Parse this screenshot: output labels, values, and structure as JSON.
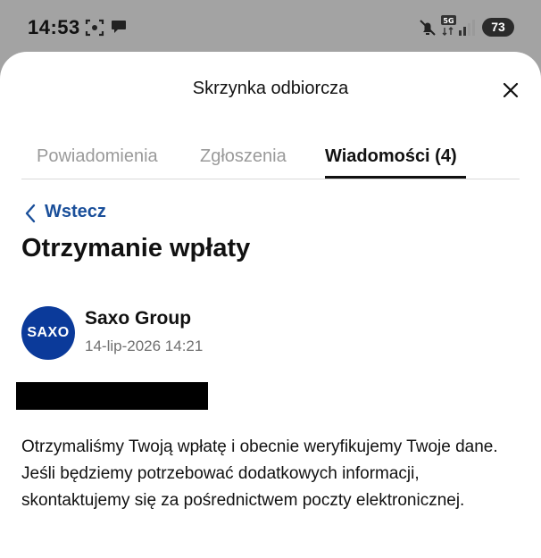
{
  "status_bar": {
    "time": "14:53",
    "battery": "73",
    "network": "5G"
  },
  "sheet": {
    "title": "Skrzynka odbiorcza"
  },
  "tabs": [
    {
      "label": "Powiadomienia",
      "active": false
    },
    {
      "label": "Zgłoszenia",
      "active": false
    },
    {
      "label": "Wiadomości (4)",
      "active": true
    }
  ],
  "back": {
    "label": "Wstecz"
  },
  "message": {
    "title": "Otrzymanie wpłaty",
    "sender": {
      "name": "Saxo Group",
      "avatar_text": "SAXO",
      "avatar_color": "#0b3a9a"
    },
    "date": "14-lip-2026 14:21",
    "body": "Otrzymaliśmy Twoją wpłatę i obecnie weryfikujemy Twoje dane. Jeśli będziemy potrzebować dodatkowych informacji, skontaktujemy się za pośrednictwem poczty elektronicznej."
  },
  "colors": {
    "accent": "#1a4f9a",
    "overlay": "#a3a3a3"
  }
}
